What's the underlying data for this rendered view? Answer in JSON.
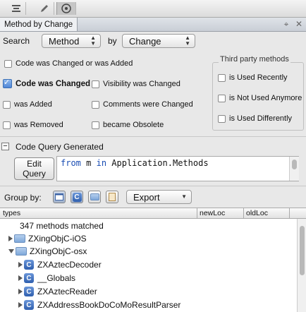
{
  "toolbar": {
    "icons": [
      "toolbar-icon",
      "edit-icon",
      "navigate-icon"
    ]
  },
  "panel": {
    "title": "Method by Change",
    "pin": "⌖",
    "close": "✕"
  },
  "search": {
    "label": "Search",
    "target": "Method",
    "by_label": "by",
    "criterion": "Change"
  },
  "checks": {
    "changed_or_added": {
      "label": "Code was Changed or was Added",
      "checked": false
    },
    "code_changed": {
      "label": "Code was Changed",
      "checked": true
    },
    "visibility_changed": {
      "label": "Visibility was Changed",
      "checked": false
    },
    "was_added": {
      "label": "was Added",
      "checked": false
    },
    "comments_changed": {
      "label": "Comments were Changed",
      "checked": false
    },
    "was_removed": {
      "label": "was Removed",
      "checked": false
    },
    "became_obsolete": {
      "label": "became Obsolete",
      "checked": false
    }
  },
  "third_party": {
    "title": "Third party methods",
    "used_recently": "is Used Recently",
    "not_used_anymore": "is Not Used Anymore",
    "used_differently": "is Used Differently"
  },
  "query": {
    "header": "Code Query Generated",
    "collapse": "−",
    "edit_line1": "Edit",
    "edit_line2": "Query",
    "kw_from": "from",
    "var": " m ",
    "kw_in": "in",
    "source": " Application.Methods"
  },
  "groupby": {
    "label": "Group by:",
    "export": "Export"
  },
  "table": {
    "columns": [
      "types",
      "newLoc",
      "oldLoc"
    ],
    "summary": "347 methods matched",
    "rows": [
      {
        "name": "ZXingObjC-iOS",
        "kind": "folder",
        "expanded": false
      },
      {
        "name": "ZXingObjC-osx",
        "kind": "folder",
        "expanded": true
      },
      {
        "name": "ZXAztecDecoder",
        "kind": "class",
        "icon": "C"
      },
      {
        "name": "__Globals",
        "kind": "class",
        "icon": "C"
      },
      {
        "name": "ZXAztecReader",
        "kind": "class",
        "icon": "C"
      },
      {
        "name": "ZXAddressBookDoCoMoResultParser",
        "kind": "class",
        "icon": "C"
      }
    ]
  }
}
